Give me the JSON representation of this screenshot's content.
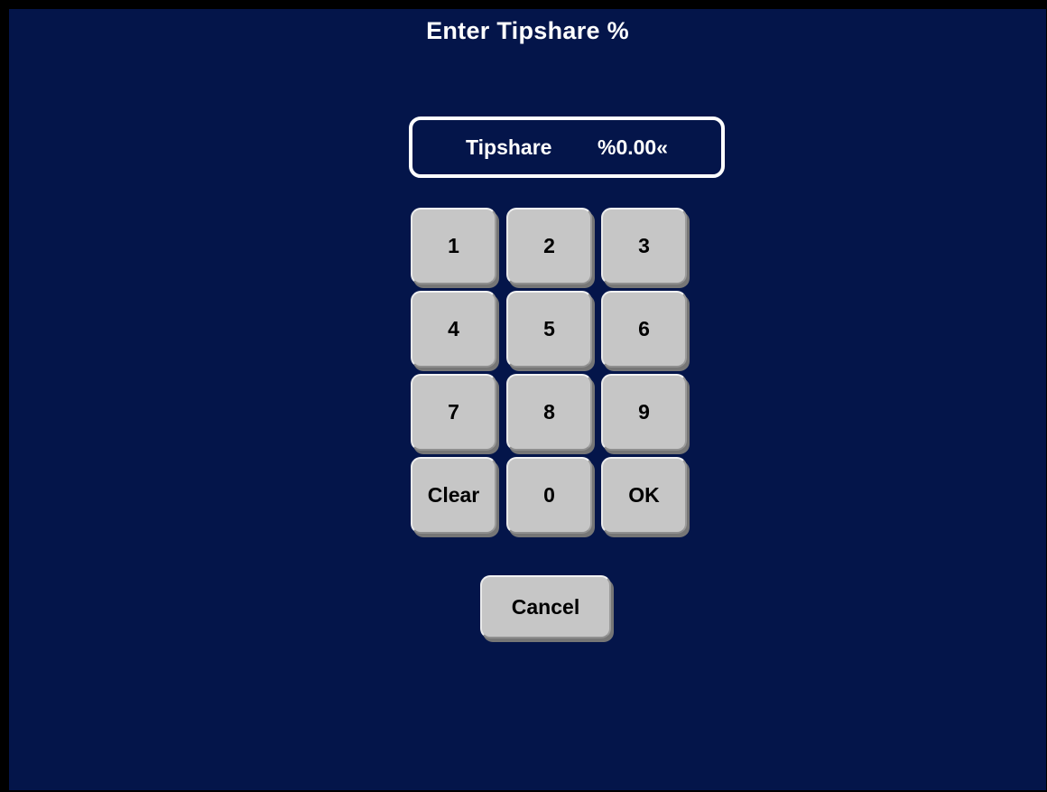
{
  "screen": {
    "background_color": "#04154a",
    "frame_color": "#000000",
    "title": "Enter Tipshare %"
  },
  "display": {
    "label": "Tipshare",
    "value": "%0.00«",
    "cursor_glyph": "«",
    "border_color": "#ffffff",
    "text_color": "#ffffff"
  },
  "keypad": {
    "face_color": "#c6c6c6",
    "text_color": "#000000",
    "keys": [
      {
        "label": "1",
        "row": 0,
        "col": 0,
        "name": "key-1"
      },
      {
        "label": "2",
        "row": 0,
        "col": 1,
        "name": "key-2"
      },
      {
        "label": "3",
        "row": 0,
        "col": 2,
        "name": "key-3"
      },
      {
        "label": "4",
        "row": 1,
        "col": 0,
        "name": "key-4"
      },
      {
        "label": "5",
        "row": 1,
        "col": 1,
        "name": "key-5"
      },
      {
        "label": "6",
        "row": 1,
        "col": 2,
        "name": "key-6"
      },
      {
        "label": "7",
        "row": 2,
        "col": 0,
        "name": "key-7"
      },
      {
        "label": "8",
        "row": 2,
        "col": 1,
        "name": "key-8"
      },
      {
        "label": "9",
        "row": 2,
        "col": 2,
        "name": "key-9"
      },
      {
        "label": "Clear",
        "row": 3,
        "col": 0,
        "name": "key-clear"
      },
      {
        "label": "0",
        "row": 3,
        "col": 1,
        "name": "key-0"
      },
      {
        "label": "OK",
        "row": 3,
        "col": 2,
        "name": "key-ok"
      }
    ]
  },
  "actions": {
    "cancel_label": "Cancel"
  }
}
